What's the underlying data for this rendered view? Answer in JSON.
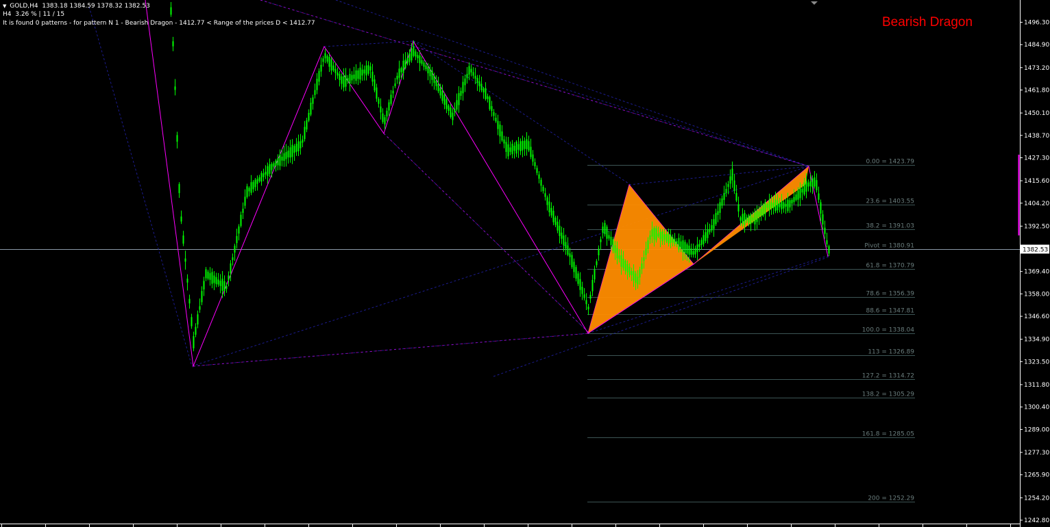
{
  "chart": {
    "symbol_header": "GOLD,H4",
    "ohlc": "1383.18 1384.59 1378.32 1382.53",
    "timeframe": "H4",
    "change_pct": "3.26 %",
    "bar_counter": "11 / 15",
    "status_line": "It is found 0 patterns  -  for pattern N 1 - Bearish Dragon  -  1412.77 < Range of the prices D < 1412.77",
    "pattern_title": "Bearish Dragon",
    "current_price": "1382.53"
  },
  "price_axis": {
    "labels": [
      "1496.30",
      "1484.90",
      "1473.20",
      "1461.80",
      "1450.10",
      "1438.70",
      "1427.30",
      "1415.60",
      "1404.20",
      "1392.50",
      "1381.10",
      "1369.40",
      "1358.00",
      "1346.60",
      "1334.90",
      "1323.50",
      "1311.80",
      "1300.40",
      "1289.00",
      "1277.30",
      "1265.90",
      "1254.20",
      "1242.80"
    ]
  },
  "fib_levels": [
    {
      "label": "0.00 = 1423.79",
      "price": 1423.79
    },
    {
      "label": "23.6 = 1403.55",
      "price": 1403.55
    },
    {
      "label": "38.2 = 1391.03",
      "price": 1391.03
    },
    {
      "label": "Pivot = 1380.91",
      "price": 1380.91
    },
    {
      "label": "61.8 = 1370.79",
      "price": 1370.79
    },
    {
      "label": "78.6 = 1356.39",
      "price": 1356.39
    },
    {
      "label": "88.6 = 1347.81",
      "price": 1347.81
    },
    {
      "label": "100.0 = 1338.04",
      "price": 1338.04
    },
    {
      "label": "113 = 1326.89",
      "price": 1326.89
    },
    {
      "label": "127.2 = 1314.72",
      "price": 1314.72
    },
    {
      "label": "138.2 = 1305.29",
      "price": 1305.29
    },
    {
      "label": "161.8 = 1285.05",
      "price": 1285.05
    },
    {
      "label": "200 = 1252.29",
      "price": 1252.29
    }
  ],
  "colors": {
    "background": "#000000",
    "candles": "#00ff00",
    "zigzag": "#ff00ff",
    "pattern_fill": "#ff8c00",
    "trend_lines": "#2020a0",
    "fib_lines": "#3d5555",
    "fib_text": "#6a7d7d",
    "title": "#ff0000",
    "axis_text": "#ffffff"
  }
}
